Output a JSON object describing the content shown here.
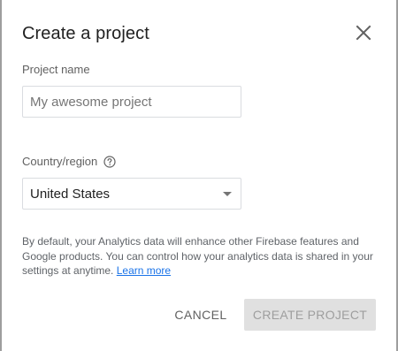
{
  "dialog": {
    "title": "Create a project",
    "close_icon": "close-icon"
  },
  "project_name": {
    "label": "Project name",
    "placeholder": "My awesome project",
    "value": ""
  },
  "country": {
    "label": "Country/region",
    "help_icon": "help-circle-icon",
    "selected": "United States",
    "dropdown_icon": "dropdown-arrow-icon"
  },
  "analytics_info": {
    "text": "By default, your Analytics data will enhance other Firebase features and Google products. You can control how your analytics data is shared in your settings at anytime.",
    "link_label": "Learn more"
  },
  "actions": {
    "cancel_label": "CANCEL",
    "create_label": "CREATE PROJECT"
  },
  "colors": {
    "link": "#1a73e8",
    "disabled_button_bg": "#e0e0e0",
    "disabled_button_text": "#9e9e9e"
  }
}
